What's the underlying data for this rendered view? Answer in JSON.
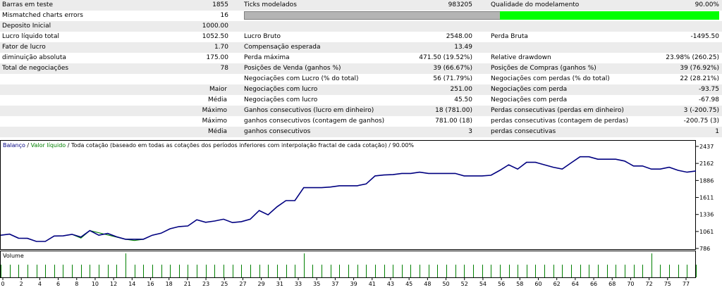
{
  "stats": {
    "bars_label": "Barras em teste",
    "bars_value": "1855",
    "ticks_label": "Ticks modelados",
    "ticks_value": "983205",
    "quality_label": "Qualidade do modelamento",
    "quality_value": "90.00%",
    "quality_fraction": 0.9,
    "mismatch_label": "Mismatched charts errors",
    "mismatch_value": "16",
    "deposit_label": "Deposito Inicial",
    "deposit_value": "1000.00",
    "net_profit_label": "Lucro líquido total",
    "net_profit_value": "1052.50",
    "gross_profit_label": "Lucro Bruto",
    "gross_profit_value": "2548.00",
    "gross_loss_label": "Perda Bruta",
    "gross_loss_value": "-1495.50",
    "profit_factor_label": "Fator de lucro",
    "profit_factor_value": "1.70",
    "expected_payoff_label": "Compensação esperada",
    "expected_payoff_value": "13.49",
    "abs_drawdown_label": "diminuição absoluta",
    "abs_drawdown_value": "175.00",
    "max_drawdown_label": "Perda máxima",
    "max_drawdown_value": "471.50 (19.52%)",
    "rel_drawdown_label": "Relative drawdown",
    "rel_drawdown_value": "23.98% (260.25)",
    "total_trades_label": "Total de negociações",
    "total_trades_value": "78",
    "short_label": "Posições de Venda (ganhos %)",
    "short_value": "39 (66.67%)",
    "long_label": "Posições de Compras (ganhos %)",
    "long_value": "39 (76.92%)",
    "profit_trades_label": "Negociações com Lucro (% do total)",
    "profit_trades_value": "56 (71.79%)",
    "loss_trades_label": "Negociações com perdas (% do total)",
    "loss_trades_value": "22 (28.21%)",
    "largest_label": "Maior",
    "largest_profit_label": "Negociações com lucro",
    "largest_profit_value": "251.00",
    "largest_loss_label": "Negociações com perda",
    "largest_loss_value": "-93.75",
    "average_label": "Média",
    "avg_profit_label": "Negociações com lucro",
    "avg_profit_value": "45.50",
    "avg_loss_label": "Negociações com perda",
    "avg_loss_value": "-67.98",
    "maximum_label": "Máximo",
    "max_cons_wins_money_label": "Ganhos consecutivos (lucro em dinheiro)",
    "max_cons_wins_money_value": "18 (781.00)",
    "max_cons_loss_money_label": "Perdas consecutivas (perdas em dinheiro)",
    "max_cons_loss_money_value": "3 (-200.75)",
    "maximal_label": "Máximo",
    "maximal_cons_profit_label": "ganhos consecutivos (contagem de ganhos)",
    "maximal_cons_profit_value": "781.00 (18)",
    "maximal_cons_loss_label": "perdas consecutivas (contagem de perdas)",
    "maximal_cons_loss_value": "-200.75 (3)",
    "average2_label": "Média",
    "avg_cons_wins_label": "ganhos consecutivos",
    "avg_cons_wins_value": "3",
    "avg_cons_loss_label": "perdas consecutivas",
    "avg_cons_loss_value": "1"
  },
  "chart_legend": {
    "balance": "Balanço",
    "sep1": " / ",
    "equity": "Valor líquido",
    "rest": " / Toda cotação (baseado em todas as cotações dos períodos inferiores com interpolação fractal de cada cotação) / 90.00%"
  },
  "volume_label": "Volume",
  "colors": {
    "balance": "#000080",
    "equity": "#008000",
    "quality_fill": "#00ff00",
    "ticks_fill": "#b4b4b4"
  },
  "chart_data": {
    "type": "line",
    "y_ticks": [
      786,
      1061,
      1336,
      1611,
      1886,
      2162,
      2437
    ],
    "ylim": [
      786,
      2437
    ],
    "x_ticks": [
      "0",
      "2",
      "4",
      "6",
      "8",
      "10",
      "12",
      "14",
      "16",
      "18",
      "21",
      "23",
      "25",
      "27",
      "29",
      "31",
      "33",
      "35",
      "37",
      "39",
      "41",
      "43",
      "45",
      "48",
      "50",
      "52",
      "54",
      "56",
      "58",
      "60",
      "62",
      "64",
      "66",
      "68",
      "70",
      "72",
      "75",
      "77"
    ],
    "xlim": [
      0,
      78
    ],
    "series": [
      {
        "name": "Balanço",
        "color": "#000080",
        "x": [
          0,
          1,
          2,
          3,
          4,
          5,
          6,
          7,
          8,
          9,
          10,
          11,
          12,
          13,
          14,
          15,
          16,
          17,
          18,
          19,
          20,
          21,
          22,
          23,
          24,
          25,
          26,
          27,
          28,
          29,
          30,
          31,
          32,
          33,
          34,
          35,
          36,
          37,
          38,
          39,
          40,
          41,
          42,
          43,
          44,
          45,
          46,
          47,
          48,
          49,
          50,
          51,
          52,
          53,
          54,
          55,
          56,
          57,
          58,
          59,
          60,
          61,
          62,
          63,
          64,
          65,
          66,
          67,
          68,
          69,
          70,
          71,
          72,
          73,
          74,
          75,
          76,
          77,
          78
        ],
        "values": [
          1000,
          1018,
          952,
          950,
          900,
          900,
          988,
          990,
          1015,
          970,
          1075,
          1000,
          1030,
          975,
          935,
          935,
          935,
          1000,
          1033,
          1105,
          1140,
          1150,
          1250,
          1210,
          1230,
          1260,
          1205,
          1220,
          1260,
          1400,
          1330,
          1460,
          1560,
          1560,
          1770,
          1770,
          1770,
          1780,
          1800,
          1800,
          1800,
          1830,
          1960,
          1975,
          1980,
          2000,
          2000,
          2020,
          2000,
          2000,
          2000,
          2000,
          1960,
          1960,
          1960,
          1970,
          2050,
          2140,
          2070,
          2180,
          2180,
          2140,
          2100,
          2070,
          2170,
          2270,
          2270,
          2230,
          2230,
          2230,
          2200,
          2120,
          2120,
          2070,
          2070,
          2100,
          2050,
          2020,
          2040
        ]
      },
      {
        "name": "Valor líquido",
        "color": "#008000",
        "x": [
          8,
          9,
          10,
          14,
          15,
          16
        ],
        "values": [
          1015,
          955,
          1075,
          935,
          915,
          935
        ]
      }
    ],
    "volume": [
      1,
      1,
      1,
      1,
      1,
      1,
      1,
      1,
      1,
      1,
      1,
      1,
      1,
      1,
      2,
      1,
      1,
      1,
      1,
      1,
      1,
      1,
      1,
      1,
      1,
      1,
      1,
      1,
      1,
      1,
      1,
      1,
      1,
      1,
      2,
      1,
      1,
      1,
      1,
      1,
      1,
      1,
      1,
      1,
      1,
      1,
      1,
      1,
      1,
      1,
      1,
      1,
      1,
      1,
      1,
      1,
      1,
      1,
      1,
      1,
      1,
      1,
      1,
      1,
      1,
      1,
      1,
      1,
      1,
      1,
      1,
      1,
      1,
      2,
      1,
      1,
      1,
      1,
      1
    ]
  }
}
